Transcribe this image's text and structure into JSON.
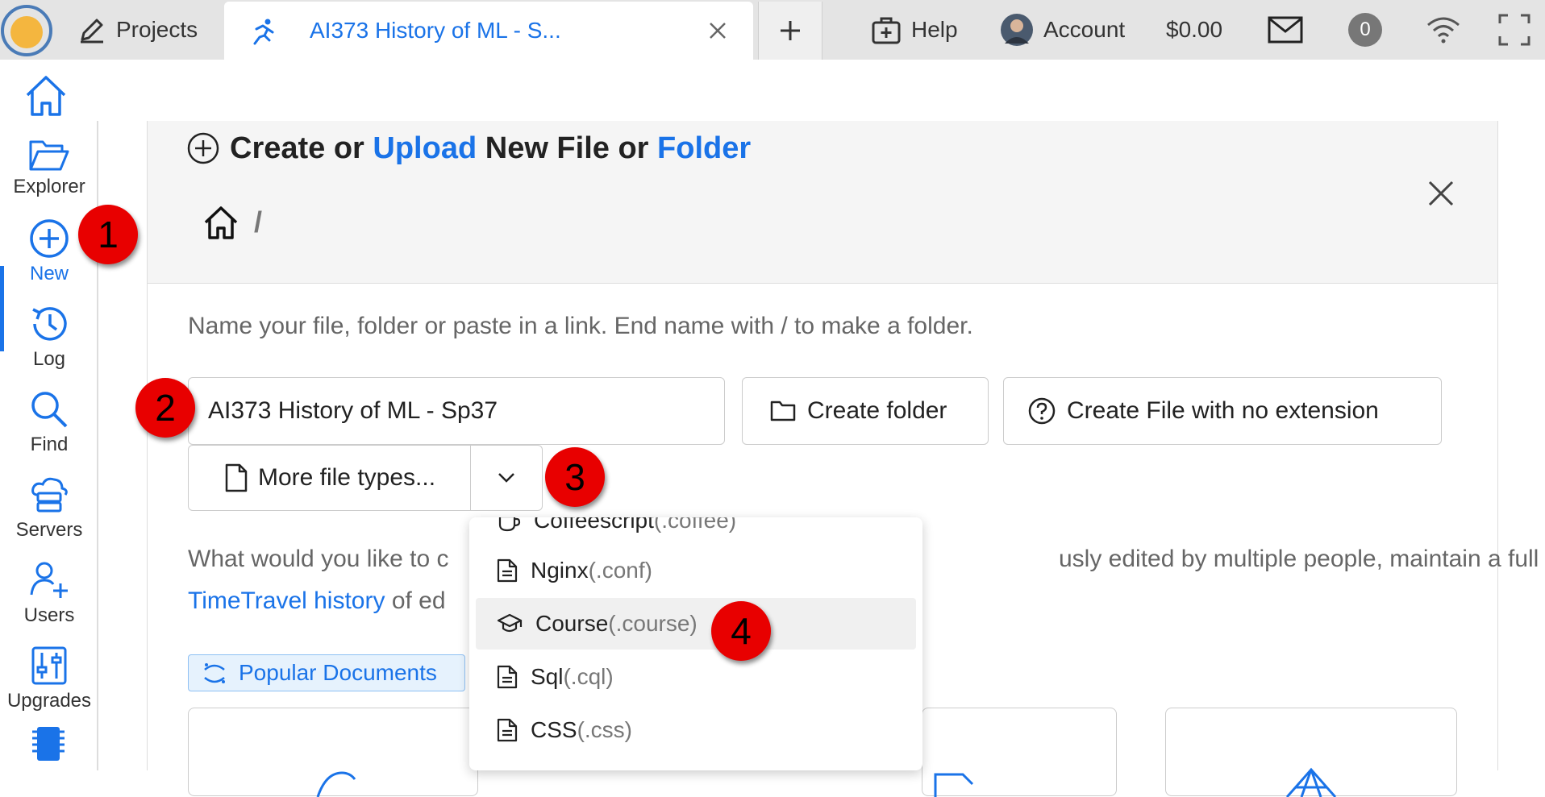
{
  "topbar": {
    "projects_label": "Projects",
    "tab_title": "AI373 History of ML - S...",
    "help_label": "Help",
    "account_label": "Account",
    "balance": "$0.00",
    "notification_count": "0"
  },
  "nav": {
    "items": [
      {
        "label": "Explorer",
        "icon": "folder-open-icon"
      },
      {
        "label": "New",
        "icon": "plus-circle-icon"
      },
      {
        "label": "Log",
        "icon": "history-icon"
      },
      {
        "label": "Find",
        "icon": "search-icon"
      },
      {
        "label": "Servers",
        "icon": "cloud-server-icon"
      },
      {
        "label": "Users",
        "icon": "users-icon"
      },
      {
        "label": "Upgrades",
        "icon": "sliders-icon"
      }
    ]
  },
  "panel": {
    "title_part1": "Create or ",
    "title_upload": "Upload",
    "title_part2": " New File or ",
    "title_folder": "Folder",
    "crumb_sep": "/",
    "hint": "Name your file, folder or paste in a link. End name with / to make a folder.",
    "name_value": "AI373 History of ML - Sp37",
    "create_folder_label": "Create folder",
    "create_noext_label": "Create File with no extension",
    "more_types_label": "More file types...",
    "para_line1a": "What would you like to c",
    "para_line1b": "usly edited by multiple people, maintain a full",
    "para_link": "TimeTravel history",
    "para_line2_rest": " of ed",
    "popular_label": "Popular Documents"
  },
  "dropdown": {
    "items": [
      {
        "name": "Coffeescript",
        "ext": "(.coffee)",
        "icon": "coffee-icon"
      },
      {
        "name": "Nginx",
        "ext": "(.conf)",
        "icon": "file-text-icon"
      },
      {
        "name": "Course",
        "ext": "(.course)",
        "icon": "graduation-cap-icon"
      },
      {
        "name": "Sql",
        "ext": "(.cql)",
        "icon": "file-text-icon"
      },
      {
        "name": "CSS",
        "ext": "(.css)",
        "icon": "file-text-icon"
      }
    ]
  },
  "callouts": [
    "1",
    "2",
    "3",
    "4"
  ],
  "colors": {
    "accent": "#1a73e8",
    "callout": "#e80000",
    "topbar": "#e4e4e4"
  }
}
